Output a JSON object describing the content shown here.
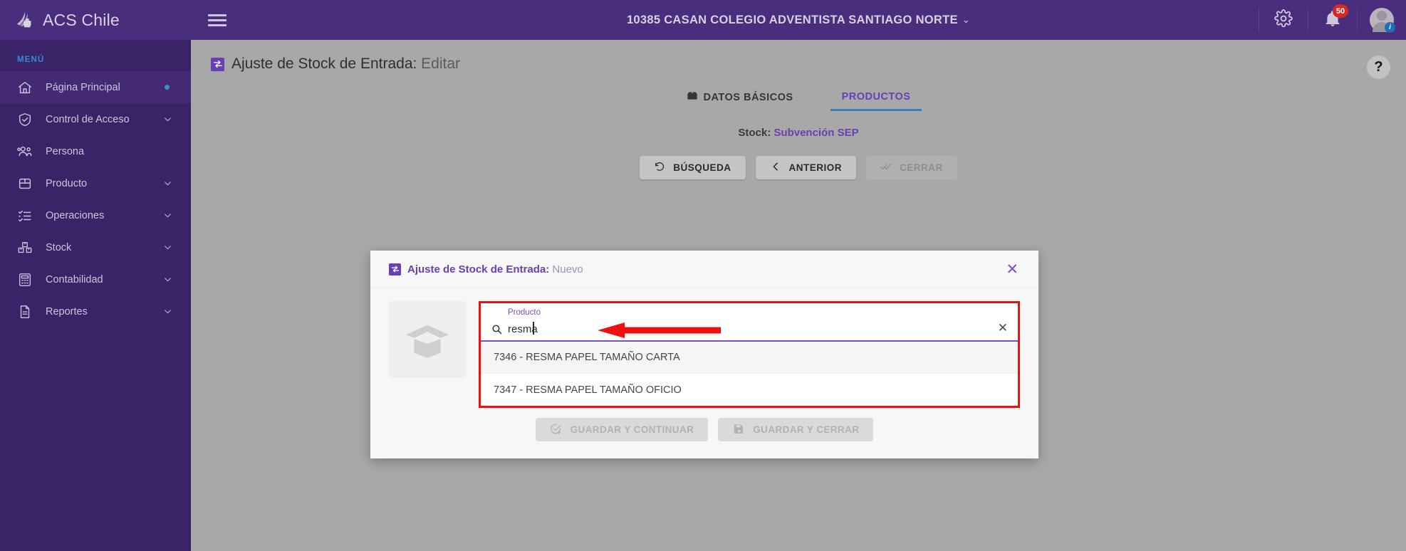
{
  "brand": {
    "name": "ACS Chile",
    "logo_icon": "acs-flame-logo"
  },
  "sidebar": {
    "menu_label": "MENÚ",
    "items": [
      {
        "label": "Página Principal",
        "icon": "home-icon",
        "active": true,
        "marker": "dot"
      },
      {
        "label": "Control de Acceso",
        "icon": "shield-check-icon",
        "active": false,
        "marker": "caret"
      },
      {
        "label": "Persona",
        "icon": "people-icon",
        "active": false,
        "marker": "none"
      },
      {
        "label": "Producto",
        "icon": "box-icon",
        "active": false,
        "marker": "caret"
      },
      {
        "label": "Operaciones",
        "icon": "checklist-icon",
        "active": false,
        "marker": "caret"
      },
      {
        "label": "Stock",
        "icon": "boxes-stack-icon",
        "active": false,
        "marker": "caret"
      },
      {
        "label": "Contabilidad",
        "icon": "calculator-icon",
        "active": false,
        "marker": "caret"
      },
      {
        "label": "Reportes",
        "icon": "document-icon",
        "active": false,
        "marker": "caret"
      }
    ]
  },
  "topbar": {
    "menu_toggle_icon": "hamburger-icon",
    "org_title": "10385 CASAN COLEGIO ADVENTISTA SANTIAGO NORTE",
    "org_caret": "⌄",
    "settings_icon": "gear-icon",
    "notifications_icon": "bell-icon",
    "notifications_count": "50",
    "profile_icon": "user-avatar-icon"
  },
  "page": {
    "icon": "stock-adjust-icon",
    "title": "Ajuste de Stock de Entrada:",
    "subtitle": "Editar",
    "help_label": "?"
  },
  "tabs": [
    {
      "label": "DATOS BÁSICOS",
      "icon": "basic-data-icon",
      "active": false
    },
    {
      "label": "PRODUCTOS",
      "icon": "",
      "active": true
    }
  ],
  "stock": {
    "label": "Stock:",
    "value": "Subvención SEP"
  },
  "actions": [
    {
      "label": "BÚSQUEDA",
      "icon": "refresh-icon",
      "disabled": false
    },
    {
      "label": "ANTERIOR",
      "icon": "chevron-left-icon",
      "disabled": false
    },
    {
      "label": "CERRAR",
      "icon": "double-check-icon",
      "disabled": true
    }
  ],
  "modal": {
    "icon": "stock-adjust-icon",
    "title": "Ajuste de Stock de Entrada:",
    "subtitle": "Nuevo",
    "close_icon": "close-icon",
    "thumbnail_icon": "open-box-placeholder-icon",
    "search": {
      "label": "Producto",
      "value": "resma",
      "placeholder": "",
      "search_icon": "search-icon",
      "clear_icon": "clear-icon"
    },
    "options": [
      {
        "label": "7346 - RESMA PAPEL TAMAÑO CARTA",
        "highlighted": true
      },
      {
        "label": "7347 - RESMA PAPEL TAMAÑO OFICIO",
        "highlighted": false
      }
    ],
    "footer_buttons": [
      {
        "label": "GUARDAR Y CONTINUAR",
        "icon": "check-plus-icon",
        "disabled": true
      },
      {
        "label": "GUARDAR Y CERRAR",
        "icon": "floppy-disk-icon",
        "disabled": true
      }
    ],
    "annotation": {
      "type": "red-arrow",
      "color": "#ee1111"
    }
  },
  "colors": {
    "sidebar_bg": "#3b2368",
    "topbar_bg": "#4a2d7d",
    "accent_purple": "#6a3fb5",
    "accent_blue": "#2f7fc4",
    "badge_red": "#dc2626",
    "annotation_red": "#ee1111",
    "content_bg": "#a8a8a8"
  }
}
